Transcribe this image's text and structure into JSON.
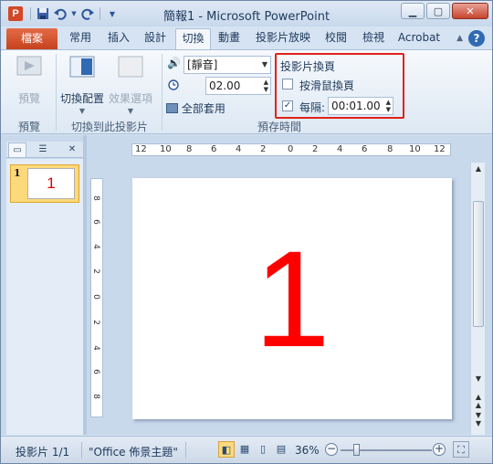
{
  "window": {
    "title": "簡報1 - Microsoft PowerPoint",
    "app_icon_letter": "P",
    "qat": [
      "save-icon",
      "undo-icon",
      "redo-icon",
      "customize-icon"
    ]
  },
  "tabs": {
    "file": "檔案",
    "items": [
      "常用",
      "插入",
      "設計",
      "切換",
      "動畫",
      "投影片放映",
      "校閱",
      "檢視",
      "Acrobat"
    ],
    "active": "切換"
  },
  "ribbon": {
    "preview": {
      "button": "預覽",
      "group": "預覽"
    },
    "transitions": {
      "scheme_button": "切換配置",
      "effects_button": "效果選項",
      "group": "切換到此投影片"
    },
    "timing": {
      "sound_value": "[靜音]",
      "duration_value": "02.00",
      "apply_all": "全部套用",
      "advance_title": "投影片換頁",
      "on_click_label": "按滑鼠換頁",
      "on_click_checked": false,
      "after_label": "每隔:",
      "after_checked": true,
      "after_value": "00:01.00",
      "group": "預存時間"
    }
  },
  "thumbnail": {
    "number": "1",
    "content": "1"
  },
  "slide": {
    "content": "1"
  },
  "ruler": {
    "horizontal": [
      "12",
      "10",
      "8",
      "6",
      "4",
      "2",
      "0",
      "2",
      "4",
      "6",
      "8",
      "10",
      "12"
    ],
    "vertical": [
      "8",
      "6",
      "4",
      "2",
      "0",
      "2",
      "4",
      "6",
      "8"
    ]
  },
  "status": {
    "slide_info": "投影片 1/1",
    "theme": "\"Office 佈景主題\"",
    "zoom": "36%"
  },
  "colors": {
    "accent": "#2b579a",
    "file_tab": "#d24726",
    "highlight_box": "#e0221c",
    "slide_number": "#ff0000"
  }
}
